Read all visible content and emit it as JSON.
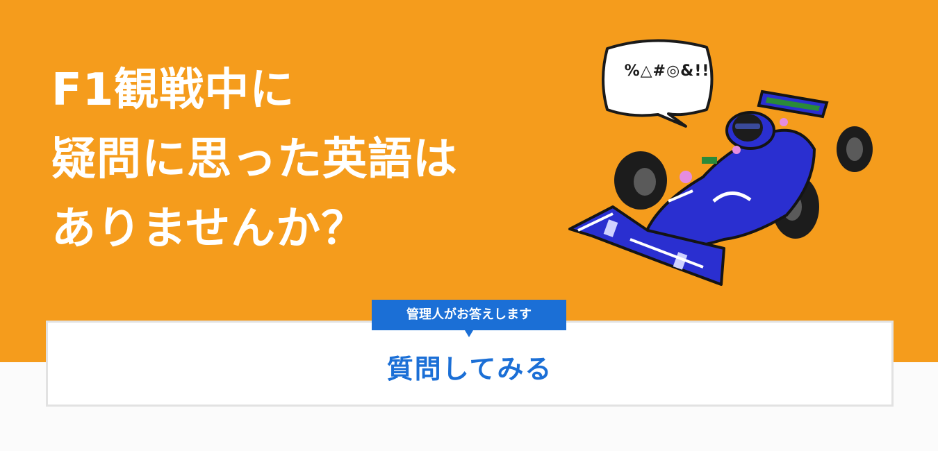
{
  "hero": {
    "headline_lines": [
      "F1観戦中に",
      "疑問に思った英語は",
      "ありませんか？"
    ],
    "speech_bubble": "%△#◎&!!",
    "background_color": "#f59c1c"
  },
  "cta": {
    "badge": "管理人がお答えします",
    "button_label": "質問してみる",
    "accent_color": "#1b6fd6"
  },
  "illustration": {
    "icon": "f1-race-car-icon"
  }
}
